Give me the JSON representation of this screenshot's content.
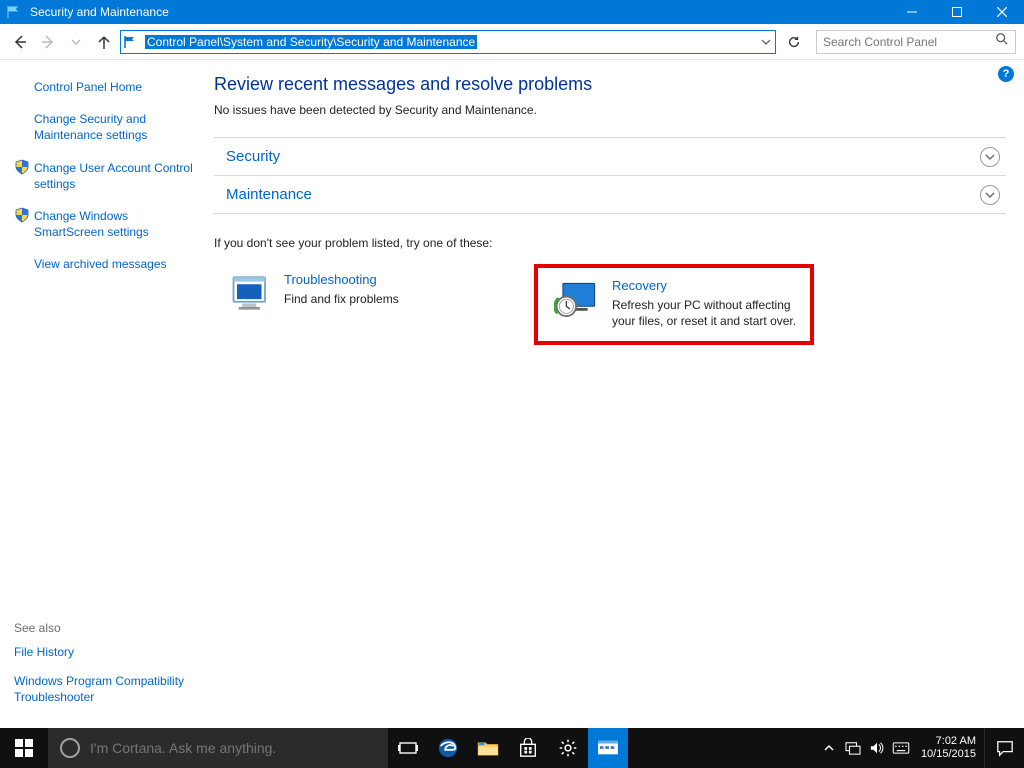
{
  "window": {
    "title": "Security and Maintenance"
  },
  "address_bar": {
    "path": "Control Panel\\System and Security\\Security and Maintenance"
  },
  "search": {
    "placeholder": "Search Control Panel"
  },
  "sidebar": {
    "items": [
      {
        "label": "Control Panel Home",
        "shield": false
      },
      {
        "label": "Change Security and Maintenance settings",
        "shield": false
      },
      {
        "label": "Change User Account Control settings",
        "shield": true
      },
      {
        "label": "Change Windows SmartScreen settings",
        "shield": true
      },
      {
        "label": "View archived messages",
        "shield": false
      }
    ],
    "see_also_label": "See also",
    "see_also": [
      {
        "label": "File History"
      },
      {
        "label": "Windows Program Compatibility Troubleshooter"
      }
    ]
  },
  "main": {
    "heading": "Review recent messages and resolve problems",
    "status": "No issues have been detected by Security and Maintenance.",
    "sections": [
      {
        "label": "Security"
      },
      {
        "label": "Maintenance"
      }
    ],
    "hint": "If you don't see your problem listed, try one of these:",
    "options": [
      {
        "title": "Troubleshooting",
        "desc": "Find and fix problems"
      },
      {
        "title": "Recovery",
        "desc": "Refresh your PC without affecting your files, or reset it and start over."
      }
    ]
  },
  "taskbar": {
    "cortana_placeholder": "I'm Cortana. Ask me anything.",
    "time": "7:02 AM",
    "date": "10/15/2015"
  },
  "help": "?"
}
